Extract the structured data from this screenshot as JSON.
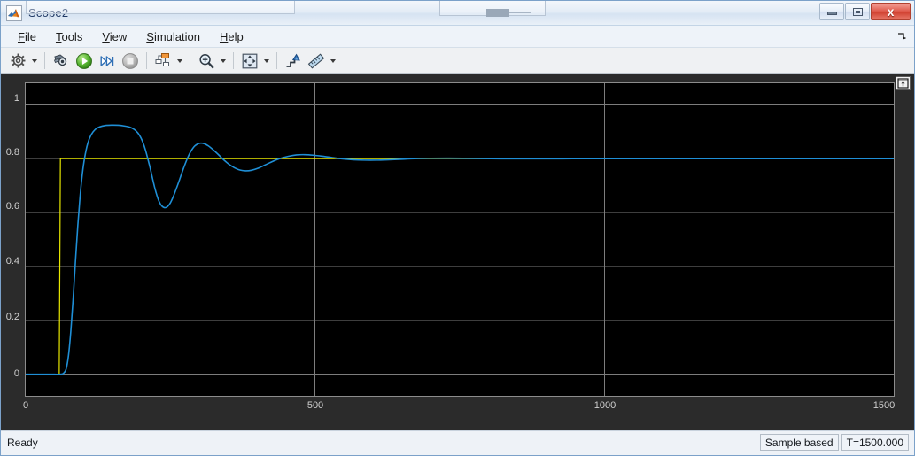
{
  "window": {
    "title": "Scope2",
    "app_icon": "matlab-membrane-icon",
    "controls": [
      {
        "name": "minimize",
        "glyph": "minimize-icon"
      },
      {
        "name": "restore",
        "glyph": "restore-icon"
      },
      {
        "name": "close",
        "glyph": "close-icon",
        "label": "x",
        "color": "#cf3d2d"
      }
    ]
  },
  "menubar": {
    "items": [
      {
        "mnemonic": "F",
        "rest": "ile"
      },
      {
        "mnemonic": "T",
        "rest": "ools"
      },
      {
        "mnemonic": "V",
        "rest": "iew"
      },
      {
        "mnemonic": "S",
        "rest": "imulation"
      },
      {
        "mnemonic": "H",
        "rest": "elp"
      }
    ],
    "overflow_icon": "menu-overflow-arrow-icon"
  },
  "toolbar": {
    "buttons": [
      {
        "name": "configuration-properties-button",
        "icon": "gear-icon",
        "dropdown": true,
        "enabled": true
      },
      {
        "name": "print-button",
        "icon": "print-scope-icon",
        "dropdown": false,
        "enabled": true
      },
      {
        "name": "run-button",
        "icon": "play-icon",
        "dropdown": false,
        "enabled": true
      },
      {
        "name": "step-forward-button",
        "icon": "step-forward-icon",
        "dropdown": false,
        "enabled": true
      },
      {
        "name": "stop-button",
        "icon": "stop-icon",
        "dropdown": false,
        "enabled": false
      },
      {
        "name": "layout-button",
        "icon": "layout-subsystem-icon",
        "dropdown": true,
        "enabled": true
      },
      {
        "name": "zoom-button",
        "icon": "zoom-in-magnifier-icon",
        "dropdown": true,
        "enabled": true
      },
      {
        "name": "pan-fit-button",
        "icon": "fit-to-view-arrows-icon",
        "dropdown": true,
        "enabled": true
      },
      {
        "name": "trigger-button",
        "icon": "trigger-arrow-icon",
        "dropdown": false,
        "enabled": true
      },
      {
        "name": "measurements-button",
        "icon": "ruler-icon",
        "dropdown": true,
        "enabled": true
      }
    ]
  },
  "plot": {
    "maximize_axes_icon": "maximize-axes-icon",
    "background": "#000000",
    "grid_color": "#808080"
  },
  "statusbar": {
    "ready": "Ready",
    "sample_mode": "Sample based",
    "time": "T=1500.000"
  },
  "chart_data": {
    "type": "line",
    "title": "",
    "xlabel": "",
    "ylabel": "",
    "xlim": [
      0,
      1500
    ],
    "ylim": [
      -0.08,
      1.08
    ],
    "xticks": [
      0,
      500,
      1000,
      1500
    ],
    "xticklabels": [
      "0",
      "500",
      "1000",
      "1500"
    ],
    "yticks": [
      0,
      0.2,
      0.4,
      0.6,
      0.8,
      1
    ],
    "yticklabels": [
      "0",
      "0.2",
      "0.4",
      "0.6",
      "0.8",
      "1"
    ],
    "grid": true,
    "legend": "none",
    "background": "#000000",
    "series": [
      {
        "name": "reference-step",
        "color": "#e8e800",
        "width": 1.2,
        "points": [
          [
            0,
            0
          ],
          [
            58,
            0
          ],
          [
            60,
            0.8
          ],
          [
            1500,
            0.8
          ]
        ]
      },
      {
        "name": "system-response",
        "color": "#1f8fd6",
        "width": 1.6,
        "points": [
          [
            0,
            0
          ],
          [
            40,
            0
          ],
          [
            60,
            0.0
          ],
          [
            66,
            0.005
          ],
          [
            70,
            0.02
          ],
          [
            74,
            0.07
          ],
          [
            78,
            0.16
          ],
          [
            82,
            0.28
          ],
          [
            86,
            0.42
          ],
          [
            90,
            0.55
          ],
          [
            94,
            0.66
          ],
          [
            98,
            0.745
          ],
          [
            102,
            0.805
          ],
          [
            107,
            0.855
          ],
          [
            113,
            0.888
          ],
          [
            120,
            0.908
          ],
          [
            128,
            0.918
          ],
          [
            137,
            0.923
          ],
          [
            148,
            0.9245
          ],
          [
            160,
            0.924
          ],
          [
            170,
            0.9215
          ],
          [
            180,
            0.917
          ],
          [
            188,
            0.908
          ],
          [
            194,
            0.895
          ],
          [
            199,
            0.878
          ],
          [
            203,
            0.858
          ],
          [
            207,
            0.832
          ],
          [
            211,
            0.8
          ],
          [
            215,
            0.766
          ],
          [
            219,
            0.728
          ],
          [
            223,
            0.692
          ],
          [
            227,
            0.662
          ],
          [
            231,
            0.639
          ],
          [
            235,
            0.625
          ],
          [
            240,
            0.618
          ],
          [
            245,
            0.622
          ],
          [
            250,
            0.636
          ],
          [
            255,
            0.659
          ],
          [
            261,
            0.693
          ],
          [
            267,
            0.729
          ],
          [
            273,
            0.766
          ],
          [
            279,
            0.799
          ],
          [
            285,
            0.826
          ],
          [
            292,
            0.847
          ],
          [
            300,
            0.857
          ],
          [
            308,
            0.856
          ],
          [
            316,
            0.847
          ],
          [
            325,
            0.831
          ],
          [
            334,
            0.813
          ],
          [
            343,
            0.794
          ],
          [
            352,
            0.778
          ],
          [
            361,
            0.766
          ],
          [
            370,
            0.758
          ],
          [
            380,
            0.755
          ],
          [
            390,
            0.757
          ],
          [
            402,
            0.765
          ],
          [
            414,
            0.777
          ],
          [
            427,
            0.79
          ],
          [
            440,
            0.801
          ],
          [
            454,
            0.809
          ],
          [
            468,
            0.814
          ],
          [
            482,
            0.815
          ],
          [
            497,
            0.813
          ],
          [
            513,
            0.809
          ],
          [
            530,
            0.804
          ],
          [
            548,
            0.799
          ],
          [
            566,
            0.796
          ],
          [
            585,
            0.7945
          ],
          [
            606,
            0.7945
          ],
          [
            628,
            0.796
          ],
          [
            651,
            0.798
          ],
          [
            675,
            0.8005
          ],
          [
            700,
            0.8015
          ],
          [
            727,
            0.8018
          ],
          [
            756,
            0.8013
          ],
          [
            788,
            0.8005
          ],
          [
            822,
            0.7998
          ],
          [
            860,
            0.7995
          ],
          [
            900,
            0.7996
          ],
          [
            945,
            0.7999
          ],
          [
            995,
            0.8001
          ],
          [
            1050,
            0.8002
          ],
          [
            1110,
            0.8001
          ],
          [
            1180,
            0.8
          ],
          [
            1260,
            0.8
          ],
          [
            1350,
            0.8
          ],
          [
            1440,
            0.8
          ],
          [
            1500,
            0.8
          ]
        ]
      }
    ]
  }
}
